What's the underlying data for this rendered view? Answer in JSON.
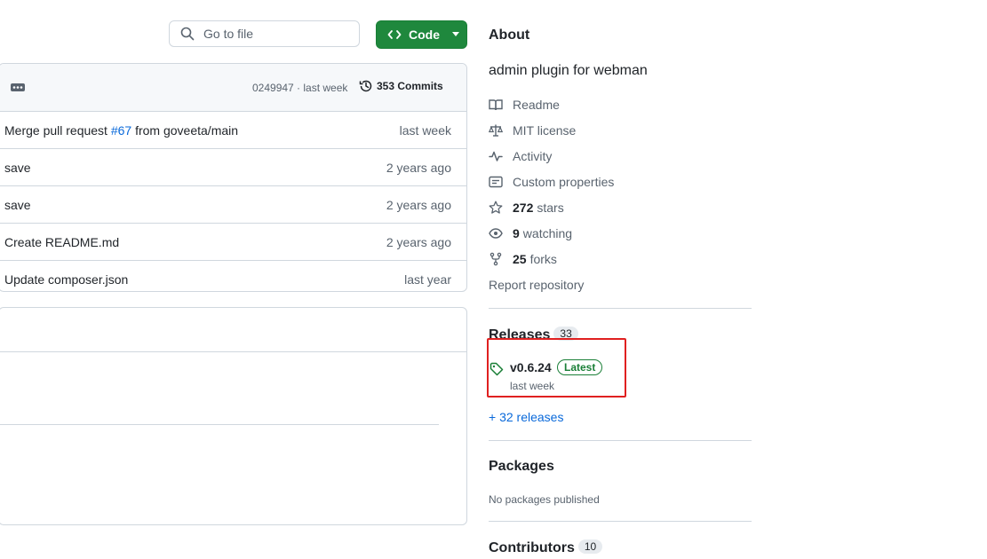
{
  "search": {
    "placeholder": "Go to file"
  },
  "code_button": {
    "label": "Code"
  },
  "latest_commit": {
    "hash": "0249947 · last week",
    "commits_count": "353 Commits"
  },
  "files": [
    {
      "msg_before": "Merge pull request ",
      "pr": "#67",
      "msg_after": " from goveeta/main",
      "when": "last week"
    },
    {
      "msg_before": "save",
      "pr": "",
      "msg_after": "",
      "when": "2 years ago"
    },
    {
      "msg_before": "save",
      "pr": "",
      "msg_after": "",
      "when": "2 years ago"
    },
    {
      "msg_before": "Create README.md",
      "pr": "",
      "msg_after": "",
      "when": "2 years ago"
    },
    {
      "msg_before": "Update composer.json",
      "pr": "",
      "msg_after": "",
      "when": "last year"
    }
  ],
  "about": {
    "title": "About",
    "description": "admin plugin for webman",
    "readme": "Readme",
    "license": "MIT license",
    "activity": "Activity",
    "custom_properties": "Custom properties",
    "stars_count": "272",
    "stars_label": "stars",
    "watching_count": "9",
    "watching_label": "watching",
    "forks_count": "25",
    "forks_label": "forks",
    "report": "Report repository"
  },
  "releases": {
    "title": "Releases",
    "count": "33",
    "version": "v0.6.24",
    "badge": "Latest",
    "date": "last week",
    "more": "+ 32 releases"
  },
  "packages": {
    "title": "Packages",
    "empty": "No packages published"
  },
  "contributors": {
    "title": "Contributors",
    "count": "10"
  },
  "colors": {
    "accent_green": "#1f883d",
    "link_blue": "#0969da",
    "highlight_red": "#e02020"
  }
}
